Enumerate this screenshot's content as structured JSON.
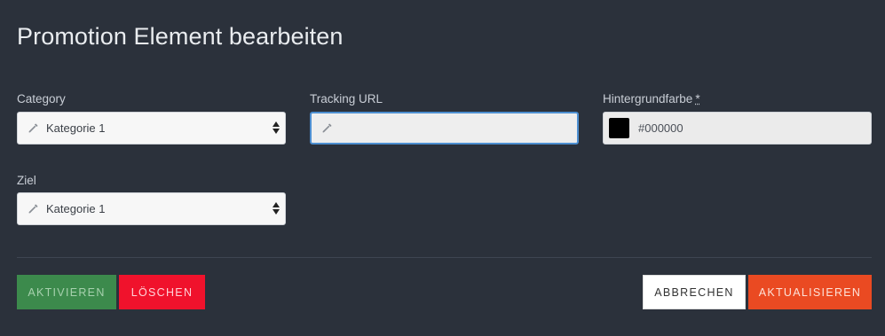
{
  "dialog": {
    "title": "Promotion Element bearbeiten"
  },
  "fields": {
    "category": {
      "label": "Category",
      "value": "Kategorie 1"
    },
    "tracking_url": {
      "label": "Tracking URL",
      "value": ""
    },
    "background_color": {
      "label": "Hintergrundfarbe",
      "required_marker": "*",
      "value": "#000000",
      "swatch_color": "#000000"
    },
    "target": {
      "label": "Ziel",
      "value": "Kategorie 1"
    }
  },
  "buttons": {
    "activate": "AKTIVIEREN",
    "delete": "LÖSCHEN",
    "cancel": "ABBRECHEN",
    "update": "AKTUALISIEREN"
  },
  "colors": {
    "background": "#2b313b",
    "activate": "#3c8a4c",
    "delete": "#f0122c",
    "update": "#ea4a22",
    "focus_border": "#4d8fd1"
  },
  "icons": {
    "field_prefix": "pencil-icon",
    "select_arrows": "select-arrows-icon"
  }
}
